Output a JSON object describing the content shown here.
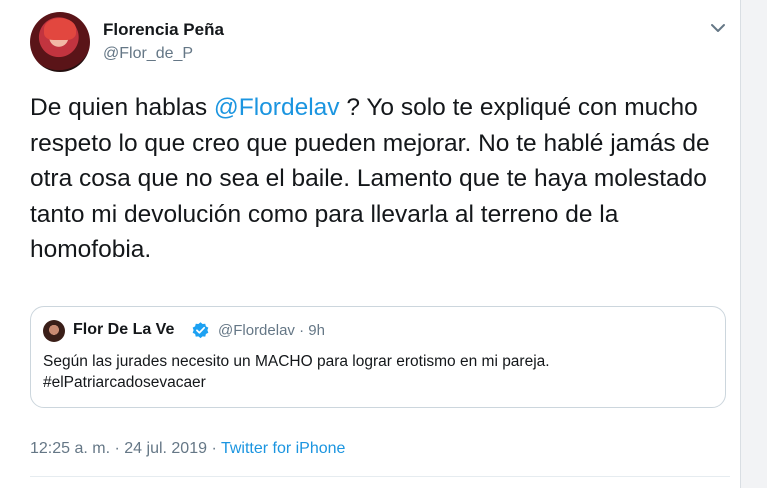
{
  "author": {
    "name": "Florencia Peña",
    "handle": "@Flor_de_P"
  },
  "tweet": {
    "text_before": "De quien hablas ",
    "mention": "@Flordelav",
    "text_after": " ? Yo solo te expliqué con mucho respeto lo que creo que pueden mejorar. No te hablé jamás de otra cosa que no sea el baile. Lamento que te haya molestado tanto mi devolución como para llevarla al terreno de la homofobia."
  },
  "quoted": {
    "name": "Flor De La Ve",
    "handle_time": "@Flordelav · 9h",
    "text_line1": "Según las jurades necesito un MACHO para lograr erotismo en mi pareja.",
    "text_line2": "#elPatriarcadosevacaer"
  },
  "meta": {
    "timestamp": "12:25 a. m. · 24 jul. 2019 · ",
    "source": "Twitter for iPhone"
  },
  "icons": {
    "more": "chevron-down-icon",
    "verified": "verified-badge-icon"
  },
  "colors": {
    "link": "#1b95e0",
    "secondary": "#657786",
    "border": "#ccd6dd"
  }
}
